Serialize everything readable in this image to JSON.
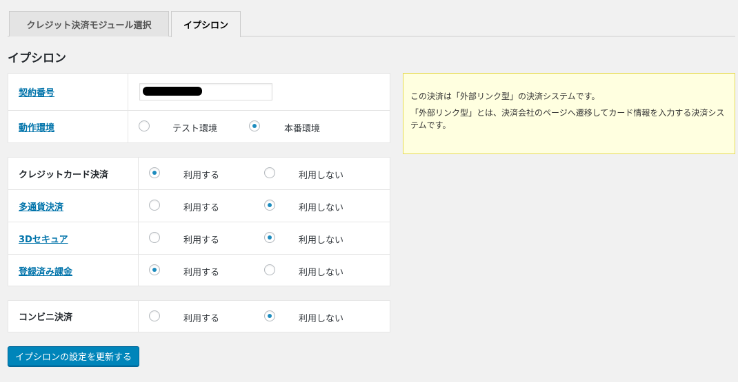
{
  "tabs": [
    {
      "label": "クレジット決済モジュール選択"
    },
    {
      "label": "イプシロン"
    }
  ],
  "page_title": "イプシロン",
  "contract": {
    "rows": [
      {
        "label": "契約番号"
      },
      {
        "label": "動作環境",
        "options": [
          "テスト環境",
          "本番環境"
        ],
        "selected": "本番環境"
      }
    ]
  },
  "payments": {
    "option_use": "利用する",
    "option_not_use": "利用しない",
    "rows": [
      {
        "label": "クレジットカード決済",
        "selected": "利用する"
      },
      {
        "label": "多通貨決済",
        "selected": "利用しない"
      },
      {
        "label": "3Dセキュア",
        "selected": "利用しない"
      },
      {
        "label": "登録済み課金",
        "selected": "利用する"
      }
    ]
  },
  "convenience": {
    "label": "コンビニ決済",
    "selected": "利用しない"
  },
  "notice": {
    "line1": "この決済は「外部リンク型」の決済システムです。",
    "line2": "「外部リンク型」とは、決済会社のページへ遷移してカード情報を入力する決済システムです。"
  },
  "submit_label": "イプシロンの設定を更新する",
  "colors": {
    "link": "#0073aa",
    "button": "#0085ba",
    "notice_bg": "#ffffe0",
    "radio_dot": "#1e8cbe"
  }
}
